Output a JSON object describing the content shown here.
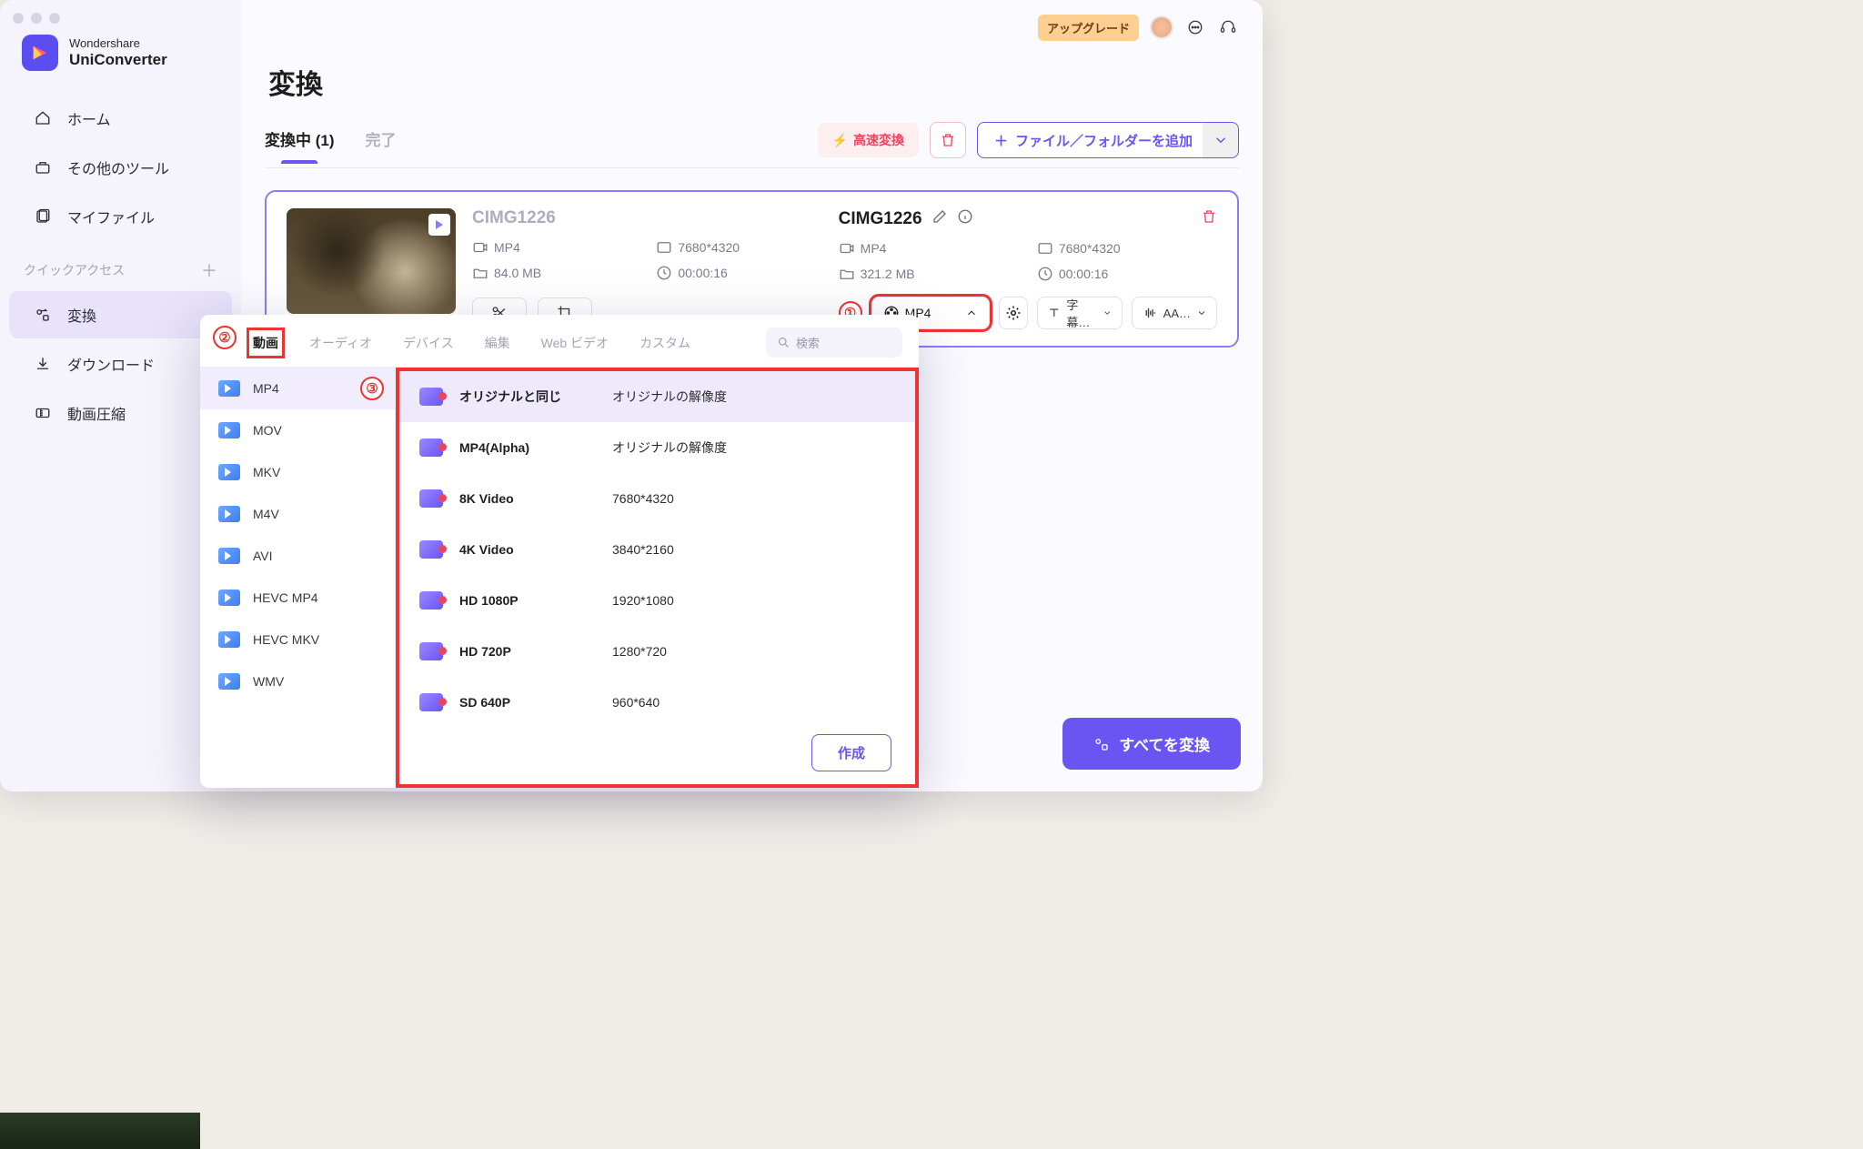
{
  "brand": {
    "company": "Wondershare",
    "product": "UniConverter"
  },
  "sidebar": {
    "items": [
      {
        "label": "ホーム"
      },
      {
        "label": "その他のツール"
      },
      {
        "label": "マイファイル"
      }
    ],
    "quick_access": "クイックアクセス",
    "quick_items": [
      {
        "label": "変換"
      },
      {
        "label": "ダウンロード"
      },
      {
        "label": "動画圧縮"
      }
    ]
  },
  "topbar": {
    "upgrade": "アップグレード"
  },
  "page": {
    "title": "変換"
  },
  "tabs": {
    "converting": "変換中 (1)",
    "done": "完了"
  },
  "actions": {
    "fast": "高速変換",
    "add": "ファイル／フォルダーを追加"
  },
  "source": {
    "name": "CIMG1226",
    "format": "MP4",
    "resolution": "7680*4320",
    "size": "84.0 MB",
    "duration": "00:00:16"
  },
  "output": {
    "name": "CIMG1226",
    "format": "MP4",
    "resolution": "7680*4320",
    "size": "321.2 MB",
    "duration": "00:00:16",
    "format_dd": "MP4",
    "subtitle": "字幕…",
    "audio": "AA…"
  },
  "convert_all": "すべてを変換",
  "popup": {
    "tabs": [
      "動画",
      "オーディオ",
      "デバイス",
      "編集",
      "Web ビデオ",
      "カスタム"
    ],
    "search_placeholder": "検索",
    "formats": [
      "MP4",
      "MOV",
      "MKV",
      "M4V",
      "AVI",
      "HEVC MP4",
      "HEVC MKV",
      "WMV"
    ],
    "presets": [
      {
        "name": "オリジナルと同じ",
        "res": "オリジナルの解像度"
      },
      {
        "name": "MP4(Alpha)",
        "res": "オリジナルの解像度"
      },
      {
        "name": "8K Video",
        "res": "7680*4320"
      },
      {
        "name": "4K Video",
        "res": "3840*2160"
      },
      {
        "name": "HD 1080P",
        "res": "1920*1080"
      },
      {
        "name": "HD 720P",
        "res": "1280*720"
      },
      {
        "name": "SD 640P",
        "res": "960*640"
      }
    ],
    "create": "作成"
  },
  "callouts": {
    "c1": "①",
    "c2": "②",
    "c3": "③"
  }
}
